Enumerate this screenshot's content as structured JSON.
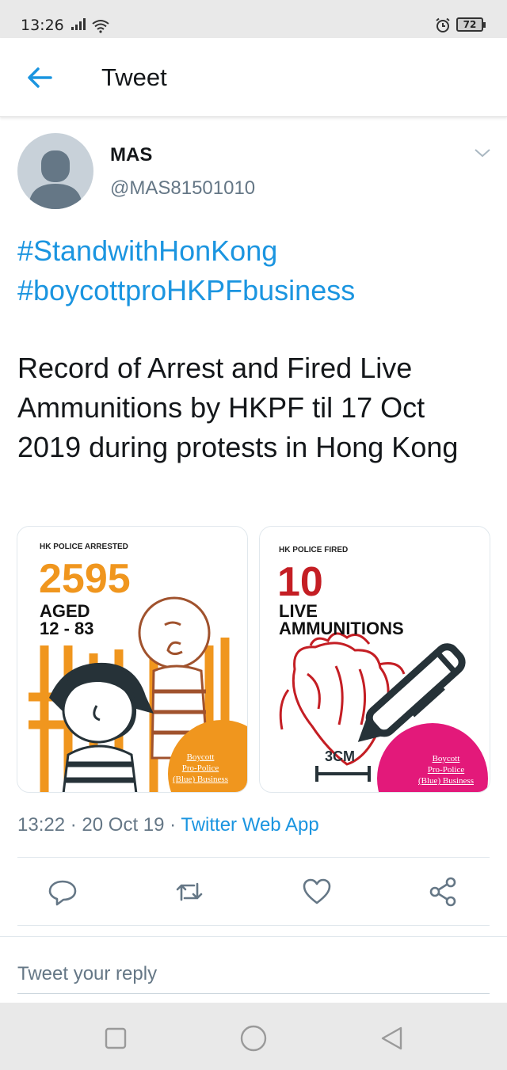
{
  "status_bar": {
    "time": "13:26",
    "battery": "72"
  },
  "header": {
    "title": "Tweet"
  },
  "tweet": {
    "author_name": "MAS",
    "author_handle": "@MAS81501010",
    "hashtags": [
      "#StandwithHonKong",
      "#boycottproHKPFbusiness"
    ],
    "text": "Record of Arrest and Fired Live Ammunitions by HKPF til 17 Oct 2019 during protests in Hong Kong",
    "media": [
      {
        "label": "HK POLICE ARRESTED",
        "number": "2595",
        "sub_lines": [
          "AGED",
          "12 - 83"
        ],
        "caption_lines": [
          "Boycott",
          "Pro-Police",
          "(Blue) Business"
        ],
        "accent": "#f0961e"
      },
      {
        "label": "HK POLICE FIRED",
        "number": "10",
        "sub_lines": [
          "LIVE",
          "AMMUNITIONS"
        ],
        "ruler_label": "3CM",
        "caption_lines": [
          "Boycott",
          "Pro-Police",
          "(Blue) Business"
        ],
        "accent": "#e3197a"
      }
    ],
    "time": "13:22",
    "date": "20 Oct 19",
    "source": "Twitter Web App"
  },
  "actions": [
    "reply-icon",
    "retweet-icon",
    "like-icon",
    "share-icon"
  ],
  "reply": {
    "placeholder": "Tweet your reply"
  },
  "colors": {
    "link": "#1b95e0",
    "muted": "#657786",
    "text": "#14171a"
  }
}
